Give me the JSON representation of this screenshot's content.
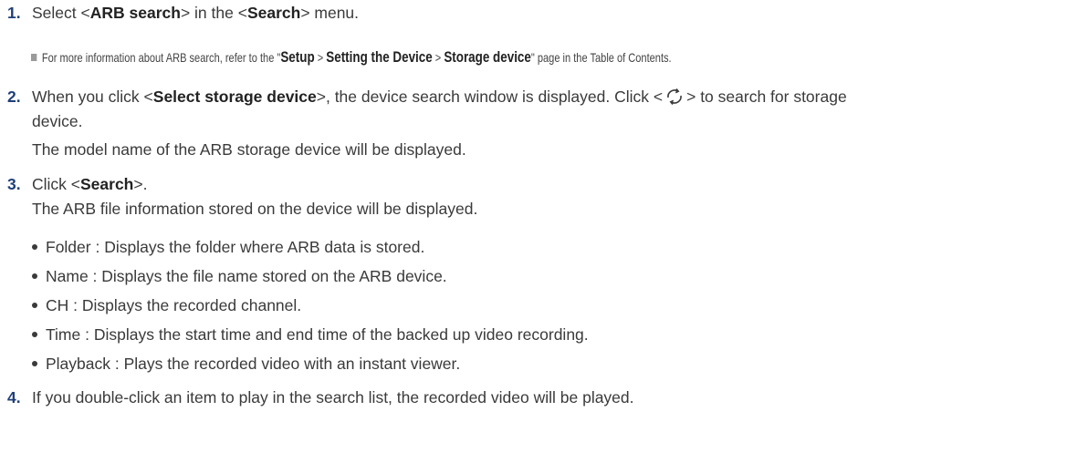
{
  "steps": [
    {
      "number": "1.",
      "pre": "Select <",
      "bold1": "ARB search",
      "mid": "> in the <",
      "bold2": "Search",
      "post": "> menu."
    },
    {
      "number": "2.",
      "pre": "When you click <",
      "bold1": "Select storage device",
      "mid": ">, the device search window is displayed. Click <",
      "mid2": "> to search for storage",
      "line2": "device.",
      "line3": "The model name of the ARB storage device will be displayed."
    },
    {
      "number": "3.",
      "pre": "Click <",
      "bold1": "Search",
      "post": ">.",
      "line2": "The ARB file information stored on the device will be displayed."
    },
    {
      "number": "4.",
      "text": "If you double-click an item to play in the search list, the recorded video will be played."
    }
  ],
  "note": {
    "pre": "For more information about ARB search, refer to the \"",
    "b1": "Setup",
    "sep1": " > ",
    "b2": "Setting the Device",
    "sep2": " > ",
    "b3": "Storage device",
    "post": "\" page in the Table of Contents."
  },
  "bullets": [
    "Folder : Displays the folder where ARB data is stored.",
    "Name : Displays the file name stored on the ARB device.",
    "CH : Displays the recorded channel.",
    "Time : Displays the start time and end time of the backed up video recording.",
    "Playback : Plays the recorded video with an instant viewer."
  ],
  "colors": {
    "number": "#1f3f7a",
    "text": "#3a3a3a",
    "note_square": "#9a9a9a"
  },
  "icons": {
    "refresh": "refresh-icon"
  }
}
